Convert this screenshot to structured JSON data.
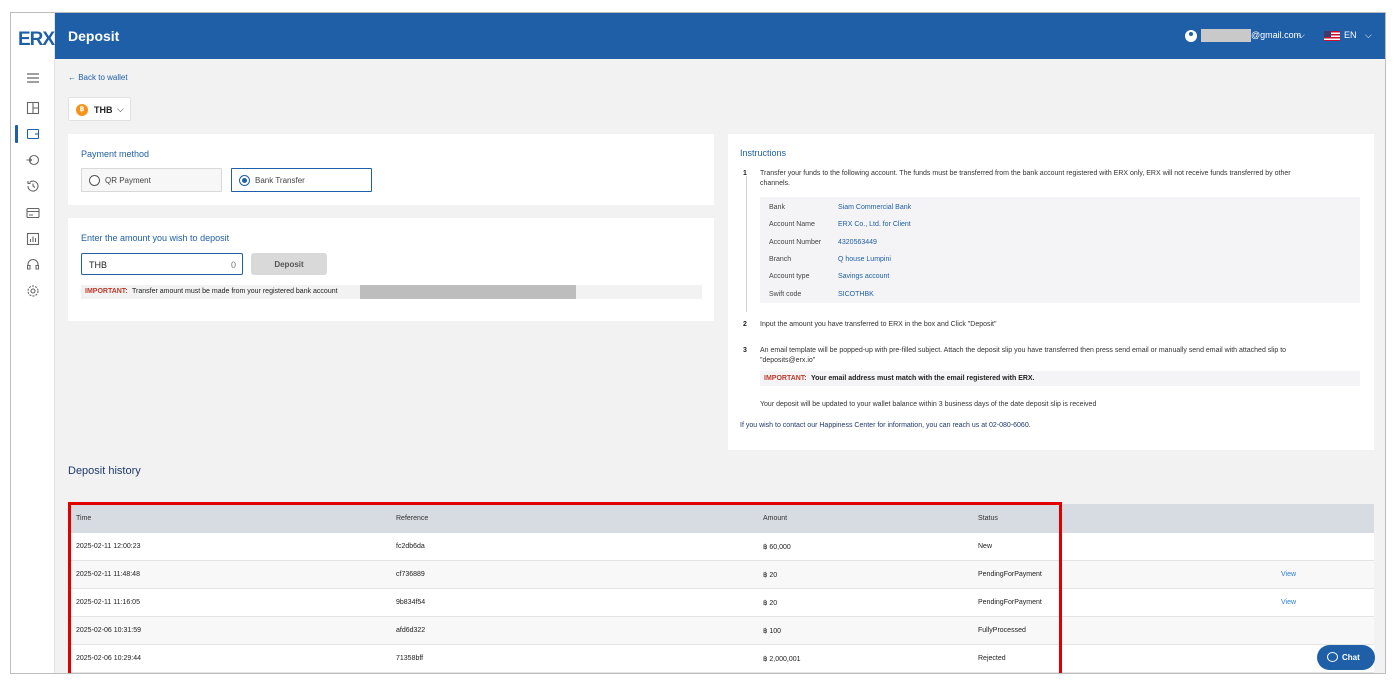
{
  "app": {
    "logo": "ERX",
    "page_title": "Deposit"
  },
  "header": {
    "email_suffix": "@gmail.com",
    "language": "EN"
  },
  "back_link": "← Back to wallet",
  "currency": {
    "code": "THB",
    "coin_glyph": "฿"
  },
  "payment_method": {
    "title": "Payment method",
    "options": [
      {
        "label": "QR Payment",
        "selected": false
      },
      {
        "label": "Bank Transfer",
        "selected": true
      }
    ]
  },
  "deposit_form": {
    "title": "Enter the amount you wish to deposit",
    "currency_label": "THB",
    "amount_placeholder": "0",
    "button_label": "Deposit",
    "important_label": "IMPORTANT:",
    "important_text": "Transfer amount must be made from your registered bank account"
  },
  "instructions": {
    "title": "Instructions",
    "step1_num": "1",
    "step1_line1": "Transfer your funds to the following account. The funds must be transferred from the bank account registered with ERX only, ERX will not receive funds transferred by other",
    "step1_line2": "channels.",
    "bank_details": [
      {
        "key": "Bank",
        "value": "Siam Commercial Bank"
      },
      {
        "key": "Account Name",
        "value": "ERX Co., Ltd. for Client"
      },
      {
        "key": "Account Number",
        "value": "4320563449"
      },
      {
        "key": "Branch",
        "value": "Q house Lumpini"
      },
      {
        "key": "Account type",
        "value": "Savings account"
      },
      {
        "key": "Swift code",
        "value": "SICOTHBK"
      }
    ],
    "step2_num": "2",
    "step2_text": "Input the amount you have transferred to ERX in the box and Click \"Deposit\"",
    "step3_num": "3",
    "step3_line1": "An email template will be popped-up with pre-filled subject. Attach the deposit slip you have transferred then press send email or manually send email with attached slip to",
    "step3_line2": "\"deposits@erx.io\"",
    "important_label": "IMPORTANT:",
    "important_text": "Your email address must match with the email registered with ERX.",
    "update_note": "Your deposit will be updated to your wallet balance within 3 business days of the date deposit slip is received",
    "contact": "If you wish to contact our Happiness Center for information, you can reach us at 02-080-6060."
  },
  "history": {
    "title": "Deposit history",
    "columns": [
      "Time",
      "Reference",
      "Amount",
      "Status"
    ],
    "rows": [
      {
        "time": "2025-02-11 12:00:23",
        "reference": "fc2db6da",
        "amount": "฿ 60,000",
        "status": "New",
        "action": ""
      },
      {
        "time": "2025-02-11 11:48:48",
        "reference": "cf736889",
        "amount": "฿ 20",
        "status": "PendingForPayment",
        "action": "View"
      },
      {
        "time": "2025-02-11 11:16:05",
        "reference": "9b834f54",
        "amount": "฿ 20",
        "status": "PendingForPayment",
        "action": "View"
      },
      {
        "time": "2025-02-06 10:31:59",
        "reference": "afd6d322",
        "amount": "฿ 100",
        "status": "FullyProcessed",
        "action": ""
      },
      {
        "time": "2025-02-06 10:29:44",
        "reference": "71358bff",
        "amount": "฿ 2,000,001",
        "status": "Rejected",
        "action": ""
      }
    ]
  },
  "chat": {
    "label": "Chat"
  },
  "colors": {
    "brand": "#1f5fa8",
    "important": "#c0392b",
    "highlight_box": "#e00000",
    "link": "#2b7de0"
  },
  "sidebar_icons": [
    "menu-icon",
    "dashboard-icon",
    "wallet-icon",
    "withdraw-icon",
    "history-icon",
    "card-icon",
    "report-icon",
    "support-icon",
    "settings-icon"
  ]
}
